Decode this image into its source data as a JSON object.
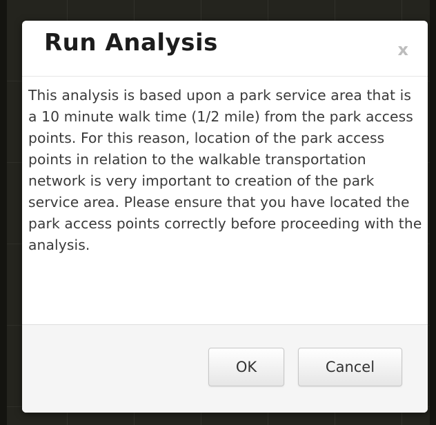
{
  "dialog": {
    "title": "Run Analysis",
    "close_label": "x",
    "message": "This analysis is based upon a park service area that is a 10 minute walk time (1/2 mile) from the park access points. For this reason, location of the park access points in relation to the walkable transportation network is very important to creation of the park service area. Please ensure that you have located the park access points correctly before proceeding with the analysis.",
    "ok_label": "OK",
    "cancel_label": "Cancel"
  },
  "colors": {
    "overlay": "#1f1f1a",
    "dialog_bg": "#ffffff",
    "footer_bg": "#f5f5f5",
    "title_text": "#1c1c1c",
    "body_text": "#3a3a3a",
    "close_icon": "#bdbdbd"
  }
}
